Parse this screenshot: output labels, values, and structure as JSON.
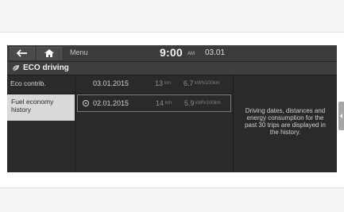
{
  "statusbar": {
    "menu_label": "Menu",
    "time": "9:00",
    "ampm": "AM",
    "date": "03.01"
  },
  "title": "ECO driving",
  "sidebar": {
    "items": [
      {
        "label": "Eco contrib.",
        "selected": false
      },
      {
        "label": "Fuel economy\nhistory",
        "selected": true
      }
    ]
  },
  "trips": [
    {
      "date": "03.01.2015",
      "distance": "13",
      "distance_unit": "km",
      "consumption": "6.7",
      "consumption_unit": "kWh/100km",
      "selected": false
    },
    {
      "date": "02.01.2015",
      "distance": "14",
      "distance_unit": "km",
      "consumption": "5.9",
      "consumption_unit": "kWh/100km",
      "selected": true
    }
  ],
  "info_text": "Driving dates, distances and energy consumption for the past 30 trips are displayed in the history.",
  "icons": {
    "back": "back-arrow-icon",
    "home": "home-icon",
    "eco": "eco-leaf-icon",
    "handle": "side-panel-handle-icon"
  },
  "colors": {
    "screen_bg": "#2a2a2a",
    "selected_tab_bg": "#d9d9d9",
    "text_light": "#cfcfcf"
  }
}
